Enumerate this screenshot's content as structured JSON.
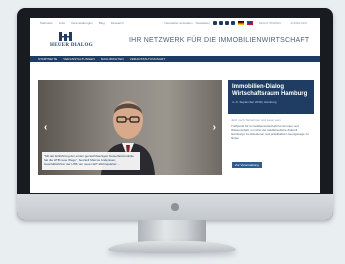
{
  "topbar": {
    "nav": [
      "Startseite",
      "Jobs",
      "Veranstaltungen",
      "Blog",
      "Research"
    ],
    "newsletter": "Newsletter anmelden",
    "newsletter_label": "Newsletter",
    "social_icons": [
      "facebook-icon",
      "twitter-icon",
      "youtube-icon",
      "xing-icon"
    ],
    "languages": [
      "DE",
      "EN"
    ],
    "register_label": "REGISTRIEREN",
    "login_label": "ANMELDEN"
  },
  "header": {
    "logo_text": "HEUER DIALOG",
    "tagline": "IHR NETZWERK FÜR DIE IMMOBILIENWIRTSCHAFT"
  },
  "mainnav": {
    "items": [
      "STARTSEITE",
      "VERANSTALTUNGEN",
      "NACHRICHTEN",
      "VERANSTALTUNGSART"
    ]
  },
  "slider": {
    "caption": "\"Mit der Einführung der ersten gemischtwertigen Gewerbeimmobilie hat die HTB neue Wege\", beurteilt Marcus Anderssen, Geschäftsführer der HTB, am neuen EIT-Wohnquartier ..."
  },
  "event": {
    "title": "Immobilien-Dialog Wirtschaftsraum Hamburg",
    "date": "4.–5. September 2018 | Hamburg",
    "label": "Jetzt noch Teilnehmer und Leser sein",
    "text": "Treffpunkt für Immobilienwirtschaft Kommunen und Wissenschaft, um über die städtebauliche Zukunft Hamburgs zu diskutieren und praktikable Lösungswege zu finden",
    "button": "Zur Veranstaltung"
  },
  "colors": {
    "primary": "#1f3d63",
    "accent": "#2f5d8a",
    "monitor_bezel": "#181c20",
    "background": "#e9eef1"
  }
}
